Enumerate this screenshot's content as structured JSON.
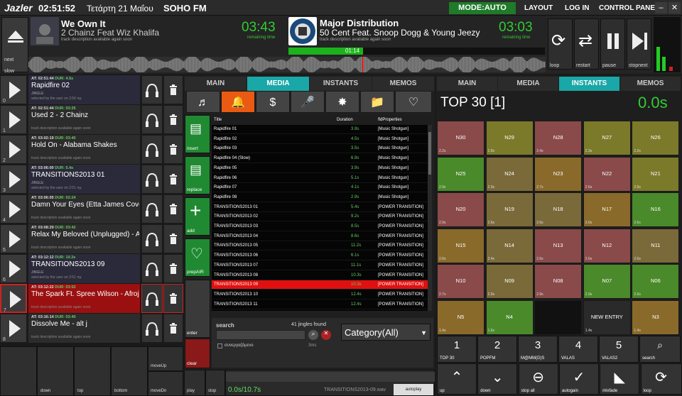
{
  "topbar": {
    "logo": "Jazler",
    "clock": "02:51:52",
    "date": "Τετάρτη 21 Μαΐου",
    "station": "SOHO FM",
    "mode": "MODE:AUTO",
    "menu": [
      "LAYOUT",
      "LOG IN",
      "CONTROL PANEL"
    ]
  },
  "player": {
    "next_label": "next",
    "slow_label": "slow",
    "left": {
      "title": "We Own It",
      "artist": "2 Chainz Feat Wiz Khalifa",
      "desc": "track description available again soon",
      "time": "03:43",
      "remaining": "remaining time"
    },
    "right": {
      "title": "Major Distribution",
      "artist": "50 Cent Feat. Snoop Dogg & Young Jeezy",
      "desc": "track description available again soon",
      "time": "03:03",
      "remaining": "remaining time",
      "progress_time": "01:14",
      "progress_fraction": 0.29
    },
    "transport": [
      {
        "label": "loop",
        "icon": "loop-icon"
      },
      {
        "label": "restart",
        "icon": "restart-icon"
      },
      {
        "label": "pause",
        "icon": "pause-icon"
      },
      {
        "label": "stopnext",
        "icon": "stopnext-icon"
      }
    ]
  },
  "playlist": [
    {
      "at": "AT: 02:51:44",
      "dur": "DUR: 4.5s",
      "name": "Rapidfire 02",
      "sub": "JINGLE",
      "sub2": "selected by the user on 2:50 πμ",
      "idx": "0",
      "active": false
    },
    {
      "at": "AT: 02:51:44",
      "dur": "DUR: 03:25",
      "name": "Used 2 - 2 Chainz",
      "sub": "",
      "sub2": "track description available again soon",
      "idx": "1",
      "active": false
    },
    {
      "at": "AT: 03:02:19",
      "dur": "DUR: 03:40",
      "name": "Hold On - Alabama Shakes",
      "sub": "",
      "sub2": "track description available again soon",
      "idx": "2",
      "active": false
    },
    {
      "at": "AT: 03:06:00",
      "dur": "DUR: 5.4s",
      "name": "TRANSITIONS2013 01",
      "sub": "JINGLE",
      "sub2": "selected by the user on 2:51 πμ",
      "idx": "3",
      "active": false
    },
    {
      "at": "AT: 03:06:05",
      "dur": "DUR: 02:24",
      "name": "Damn Your Eyes (Etta James Cover) - Alex Clare",
      "sub": "",
      "sub2": "track description available again soon",
      "idx": "4",
      "active": false
    },
    {
      "at": "AT: 03:08:29",
      "dur": "DUR: 03:42",
      "name": "Relax My Beloved (Unplugged) - Alex Clare",
      "sub": "",
      "sub2": "track description available again soon",
      "idx": "5",
      "active": false
    },
    {
      "at": "AT: 03:12:12",
      "dur": "DUR: 10.3s",
      "name": "TRANSITIONS2013 09",
      "sub": "JINGLE",
      "sub2": "selected by the user on 2:51 πμ",
      "idx": "6",
      "active": false
    },
    {
      "at": "AT: 03:12:22",
      "dur": "DUR: 03:52",
      "name": "The Spark Ft. Spree Wilson - Afrojack",
      "sub": "",
      "sub2": "track description available again soon",
      "idx": "7",
      "active": true
    },
    {
      "at": "AT: 03:16:14",
      "dur": "DUR: 03:40",
      "name": "Dissolve Me - alt j",
      "sub": "",
      "sub2": "track description available again soon",
      "idx": "8",
      "active": false
    }
  ],
  "left_bottom": [
    "down",
    "top",
    "bottom",
    "moveUp",
    "moveDn"
  ],
  "media": {
    "tabs": [
      "MAIN",
      "MEDIA",
      "INSTANTS",
      "MEMOS"
    ],
    "active_tab": 1,
    "side_buttons": [
      "insert",
      "replace",
      "add",
      "prepAIR",
      "enter",
      "clear"
    ],
    "columns": [
      "Title",
      "Duration",
      "fldProperties"
    ],
    "rows": [
      [
        "Rapidfire 01",
        "3.9s",
        "[Music Shotgun]"
      ],
      [
        "Rapidfire 02",
        "4.5s",
        "[Music Shotgun]"
      ],
      [
        "Rapidfire 03",
        "3.5s",
        "[Music Shotgun]"
      ],
      [
        "Rapidfire 04 (Slow)",
        "6.9s",
        "[Music Shotgun]"
      ],
      [
        "Rapidfire 05",
        "3.9s",
        "[Music Shotgun]"
      ],
      [
        "Rapidfire 06",
        "5.1s",
        "[Music Shotgun]"
      ],
      [
        "Rapidfire 07",
        "4.1s",
        "[Music Shotgun]"
      ],
      [
        "Rapidfire 08",
        "2.9s",
        "[Music Shotgun]"
      ],
      [
        "TRANSITIONS2013 01",
        "5.4s",
        "[POWER TRANSITION]"
      ],
      [
        "TRANSITIONS2013 02",
        "9.2s",
        "[POWER TRANSITION]"
      ],
      [
        "TRANSITIONS2013 03",
        "8.5s",
        "[POWER TRANSITION]"
      ],
      [
        "TRANSITIONS2013 04",
        "8.6s",
        "[POWER TRANSITION]"
      ],
      [
        "TRANSITIONS2013 05",
        "11.2s",
        "[POWER TRANSITION]"
      ],
      [
        "TRANSITIONS2013 06",
        "6.1s",
        "[POWER TRANSITION]"
      ],
      [
        "TRANSITIONS2013 07",
        "11.1s",
        "[POWER TRANSITION]"
      ],
      [
        "TRANSITIONS2013 08",
        "10.3s",
        "[POWER TRANSITION]"
      ],
      [
        "TRANSITIONS2013 09",
        "10.3s",
        "[POWER TRANSITION]"
      ],
      [
        "TRANSITIONS2013 10",
        "12.4s",
        "[POWER TRANSITION]"
      ],
      [
        "TRANSITIONS2013 11",
        "12.4s",
        "[POWER TRANSITION]"
      ]
    ],
    "selected_row": 16,
    "search_label": "search",
    "found": "41 jingles found",
    "checkbox_label": "συνεργαζόμενο",
    "ms": "3ms",
    "category": "Category(All)",
    "play": "play",
    "stop": "stop",
    "time": "0.0s/10.7s",
    "file": "TRANSITIONS2013-09.wav",
    "autoplay": "autoplay"
  },
  "instants": {
    "tabs": [
      "MAIN",
      "MEDIA",
      "INSTANTS",
      "MEMOS"
    ],
    "active_tab": 2,
    "title": "TOP 30 [1]",
    "time": "0.0s",
    "cells": [
      {
        "t": "N30",
        "d": "2.2s",
        "c": "#8a4a4a"
      },
      {
        "t": "N29",
        "d": "2.9s",
        "c": "#7a7a2a"
      },
      {
        "t": "N28",
        "d": "2.4s",
        "c": "#8a4a4a"
      },
      {
        "t": "N27",
        "d": "2.3s",
        "c": "#7a7a2a"
      },
      {
        "t": "N26",
        "d": "2.2s",
        "c": "#7a7a2a"
      },
      {
        "t": "N25",
        "d": "2.9s",
        "c": "#4a8a2a"
      },
      {
        "t": "N24",
        "d": "2.9s",
        "c": "#7a6a3a"
      },
      {
        "t": "N23",
        "d": "2.7s",
        "c": "#8a6a2a"
      },
      {
        "t": "N22",
        "d": "2.6s",
        "c": "#8a4a4a"
      },
      {
        "t": "N21",
        "d": "2.9s",
        "c": "#7a7a2a"
      },
      {
        "t": "N20",
        "d": "2.9s",
        "c": "#8a4a4a"
      },
      {
        "t": "N19",
        "d": "2.6s",
        "c": "#7a6a3a"
      },
      {
        "t": "N18",
        "d": "2.6s",
        "c": "#7a6a3a"
      },
      {
        "t": "N17",
        "d": "2.6s",
        "c": "#8a6a2a"
      },
      {
        "t": "N16",
        "d": "2.6s",
        "c": "#4a8a2a"
      },
      {
        "t": "N15",
        "d": "2.6s",
        "c": "#8a6a2a"
      },
      {
        "t": "N14",
        "d": "2.4s",
        "c": "#7a6a3a"
      },
      {
        "t": "N13",
        "d": "2.6s",
        "c": "#8a4a4a"
      },
      {
        "t": "N12",
        "d": "2.6s",
        "c": "#8a4a4a"
      },
      {
        "t": "N11",
        "d": "2.6s",
        "c": "#7a6a3a"
      },
      {
        "t": "N10",
        "d": "2.7s",
        "c": "#8a4a4a"
      },
      {
        "t": "N09",
        "d": "2.9s",
        "c": "#7a6a3a"
      },
      {
        "t": "N08",
        "d": "2.9s",
        "c": "#8a4a4a"
      },
      {
        "t": "N07",
        "d": "2.9s",
        "c": "#4a8a2a"
      },
      {
        "t": "N06",
        "d": "2.9s",
        "c": "#4a8a2a"
      },
      {
        "t": "N5",
        "d": "1.4s",
        "c": "#8a6a2a"
      },
      {
        "t": "N4",
        "d": "1.6s",
        "c": "#4a8a2a"
      },
      {
        "t": "",
        "d": "",
        "c": "#111111"
      },
      {
        "t": "NEW ENTRY",
        "d": "1.4s",
        "c": "#2a2a2a"
      },
      {
        "t": "N3",
        "d": "1.4s",
        "c": "#8a6a2a"
      }
    ],
    "numbers": [
      {
        "n": "1",
        "l": "TOP 30"
      },
      {
        "n": "2",
        "l": "POPFM"
      },
      {
        "n": "3",
        "l": "M@MM(D)S"
      },
      {
        "n": "4",
        "l": "VALAS"
      },
      {
        "n": "5",
        "l": "VALAS2"
      }
    ],
    "search_label": "search",
    "nav": [
      "up",
      "down",
      "stop all",
      "autogain",
      "mixfade",
      "loop"
    ]
  }
}
